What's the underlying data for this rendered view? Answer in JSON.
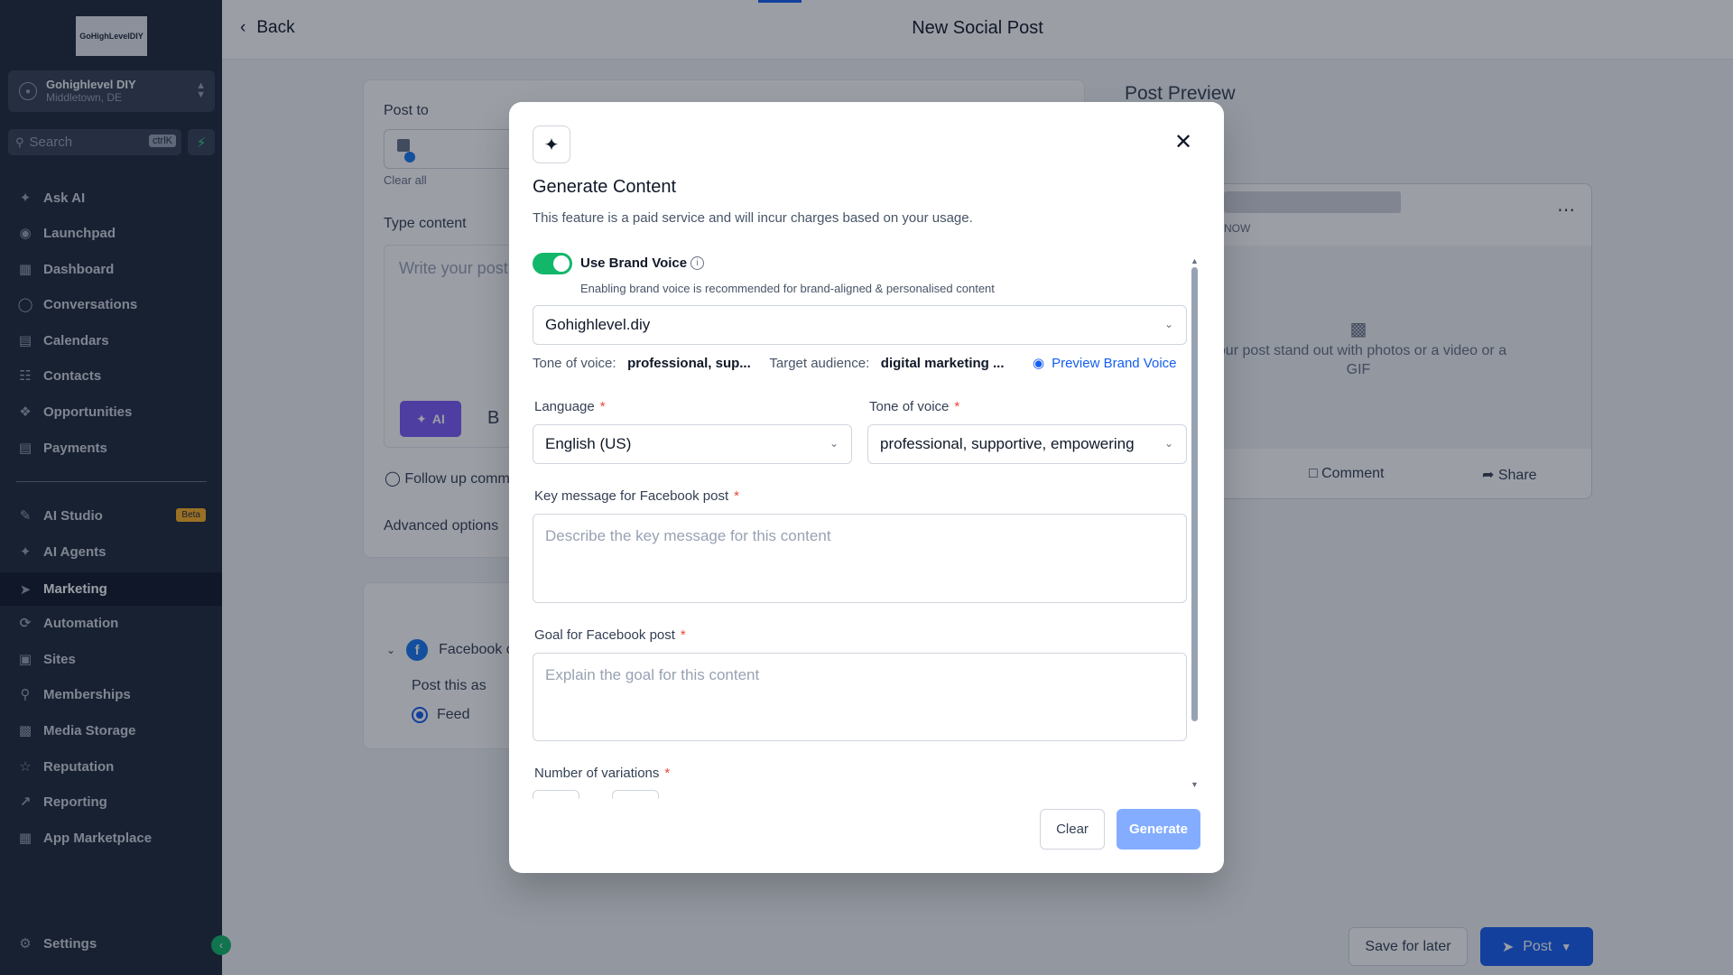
{
  "sidebar": {
    "logo_text": "GoHighLevelDIY",
    "account": {
      "name": "Gohighlevel DIY",
      "location": "Middletown,  DE"
    },
    "search": {
      "placeholder": "Search",
      "shortcut": "ctrlK"
    },
    "items": [
      {
        "label": "Ask AI",
        "icon": "sparkle-icon"
      },
      {
        "label": "Launchpad",
        "icon": "rocket-icon"
      },
      {
        "label": "Dashboard",
        "icon": "grid-icon"
      },
      {
        "label": "Conversations",
        "icon": "chat-icon"
      },
      {
        "label": "Calendars",
        "icon": "calendar-icon"
      },
      {
        "label": "Contacts",
        "icon": "contacts-icon"
      },
      {
        "label": "Opportunities",
        "icon": "opportunities-icon"
      },
      {
        "label": "Payments",
        "icon": "receipt-icon"
      },
      {
        "label": "AI Studio",
        "icon": "ai-studio-icon",
        "badge": "Beta"
      },
      {
        "label": "AI Agents",
        "icon": "sparkle-icon"
      },
      {
        "label": "Marketing",
        "icon": "send-icon",
        "active": true
      },
      {
        "label": "Automation",
        "icon": "automation-icon"
      },
      {
        "label": "Sites",
        "icon": "sites-icon"
      },
      {
        "label": "Memberships",
        "icon": "membership-icon"
      },
      {
        "label": "Media Storage",
        "icon": "image-icon"
      },
      {
        "label": "Reputation",
        "icon": "star-icon"
      },
      {
        "label": "Reporting",
        "icon": "chart-icon"
      },
      {
        "label": "App Marketplace",
        "icon": "apps-icon"
      }
    ],
    "settings_label": "Settings"
  },
  "header": {
    "back_label": "Back",
    "title": "New Social Post"
  },
  "composer": {
    "post_to_label": "Post to",
    "clear_all_label": "Clear all",
    "type_content_label": "Type content",
    "editor_placeholder": "Write your post",
    "ai_button_label": "AI",
    "bold_label": "B",
    "follow_up_label": "Follow up comm",
    "advanced_label": "Advanced options",
    "facebook_label": "Facebook c",
    "post_as_label": "Post this as",
    "feed_label": "Feed"
  },
  "preview": {
    "title": "Post Preview",
    "timestamp": "NOW",
    "media_text": "your post stand out with photos or a video or a GIF",
    "comment_label": "Comment",
    "share_label": "Share"
  },
  "footer": {
    "save_later_label": "Save for later",
    "post_label": "Post"
  },
  "modal": {
    "title": "Generate Content",
    "subtitle": "This feature is a paid service and will incur charges based on your usage.",
    "brand_voice": {
      "label": "Use Brand Voice",
      "enabled": true,
      "help": "Enabling brand voice is recommended for brand-aligned & personalised content",
      "selected": "Gohighlevel.diy",
      "tone_label": "Tone of voice:",
      "tone_value": "professional, sup...",
      "audience_label": "Target audience:",
      "audience_value": "digital marketing ...",
      "preview_label": "Preview Brand Voice"
    },
    "language": {
      "label": "Language",
      "value": "English (US)"
    },
    "tone": {
      "label": "Tone of voice",
      "value": "professional, supportive, empowering"
    },
    "key_message": {
      "label": "Key message for Facebook post",
      "placeholder": "Describe the key message for this content"
    },
    "goal": {
      "label": "Goal for Facebook post",
      "placeholder": "Explain the goal for this content"
    },
    "variations_label": "Number of variations",
    "required_mark": "*",
    "clear_label": "Clear",
    "generate_label": "Generate"
  },
  "colors": {
    "sidebar_bg": "#1d2939",
    "accent": "#155eef",
    "toggle_on": "#12b76a",
    "ai_purple": "#7a5af8"
  }
}
